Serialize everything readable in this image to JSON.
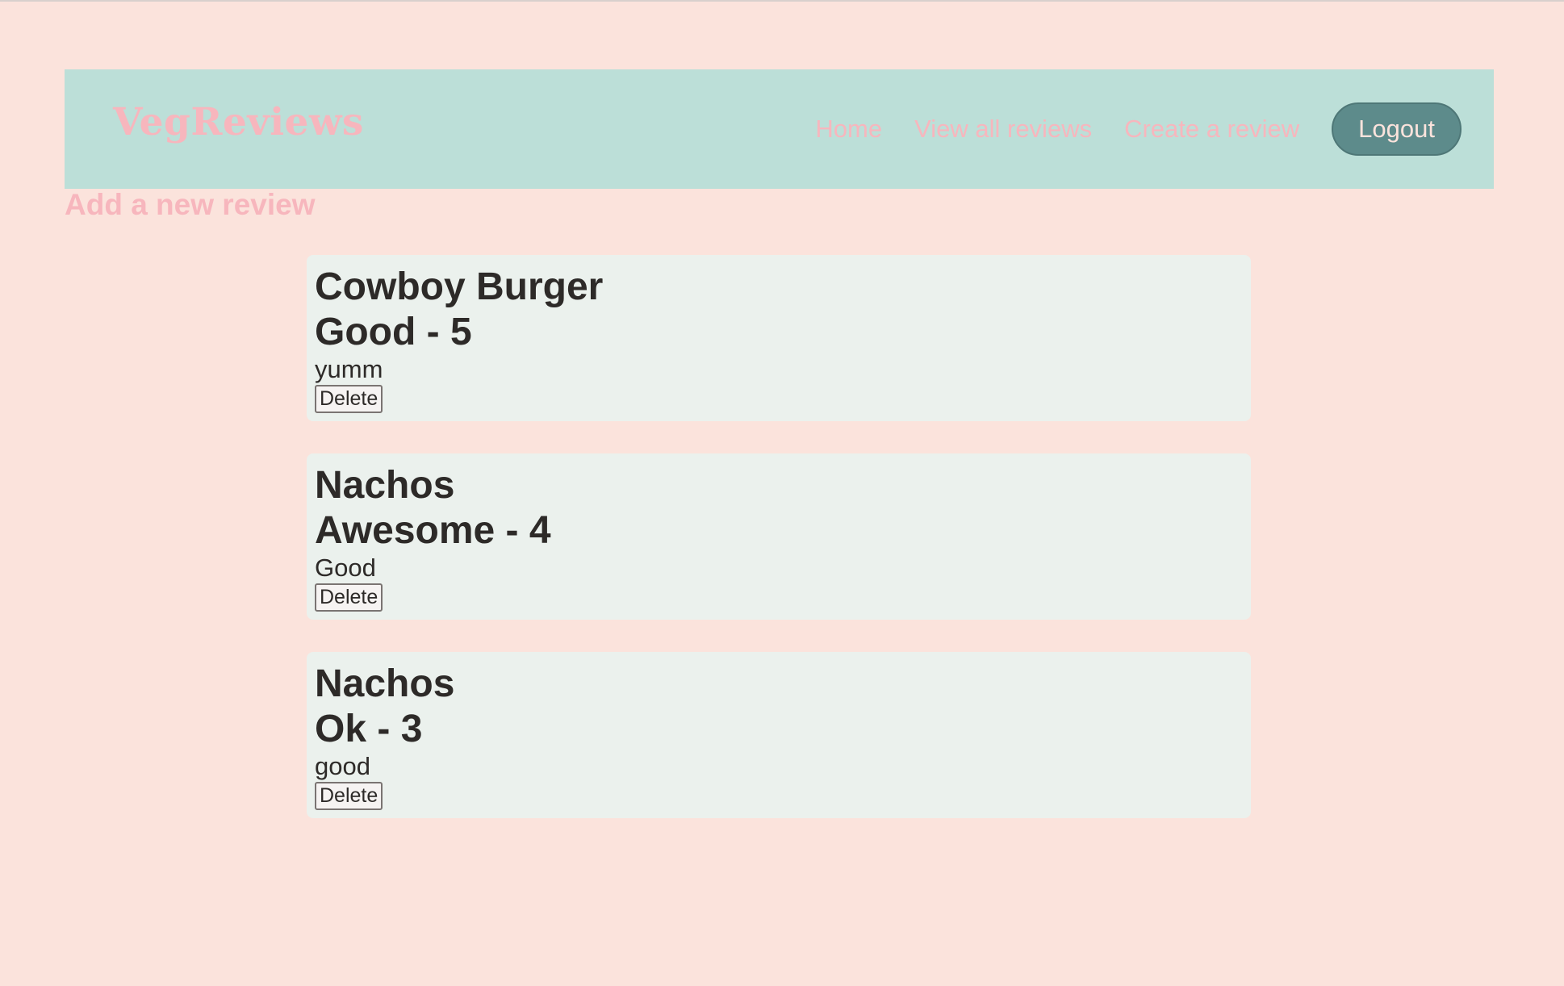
{
  "app": {
    "brand": "VegReviews"
  },
  "nav": {
    "links": [
      "Home",
      "View all reviews",
      "Create a review"
    ],
    "logout_label": "Logout"
  },
  "page": {
    "add_review_link": "Add a new review"
  },
  "reviews": [
    {
      "title": "Cowboy Burger",
      "rating": "Good - 5",
      "text": "yumm",
      "delete_label": "Delete"
    },
    {
      "title": "Nachos",
      "rating": "Awesome - 4",
      "text": "Good",
      "delete_label": "Delete"
    },
    {
      "title": "Nachos",
      "rating": "Ok - 3",
      "text": "good",
      "delete_label": "Delete"
    }
  ],
  "colors": {
    "background": "#fbe3dc",
    "navbar": "#bcdfd8",
    "accent_pink": "#f7b6bd",
    "logout_button": "#5d8b8b",
    "card": "#ebf1ed",
    "text": "#2d2a28"
  }
}
